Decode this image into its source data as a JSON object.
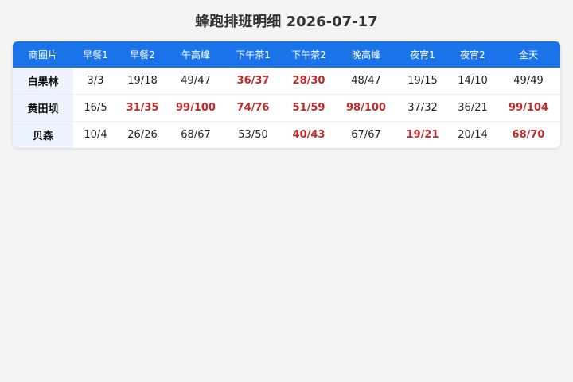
{
  "title": "蜂跑排班明细 2026-07-17",
  "colors": {
    "header_bg": "#1a73e8",
    "hot_text": "#c62828",
    "area_bg": "#eef4ff"
  },
  "table": {
    "headers": [
      "商圈片",
      "早餐1",
      "早餐2",
      "午高峰",
      "下午茶1",
      "下午茶2",
      "晚高峰",
      "夜宵1",
      "夜宵2",
      "全天"
    ],
    "rows": [
      {
        "area": "白果林",
        "cells": [
          {
            "v": "3/3",
            "hot": false
          },
          {
            "v": "19/18",
            "hot": false
          },
          {
            "v": "49/47",
            "hot": false
          },
          {
            "v": "36/37",
            "hot": true
          },
          {
            "v": "28/30",
            "hot": true
          },
          {
            "v": "48/47",
            "hot": false
          },
          {
            "v": "19/15",
            "hot": false
          },
          {
            "v": "14/10",
            "hot": false
          },
          {
            "v": "49/49",
            "hot": false
          }
        ]
      },
      {
        "area": "黄田坝",
        "cells": [
          {
            "v": "16/5",
            "hot": false
          },
          {
            "v": "31/35",
            "hot": true
          },
          {
            "v": "99/100",
            "hot": true
          },
          {
            "v": "74/76",
            "hot": true
          },
          {
            "v": "51/59",
            "hot": true
          },
          {
            "v": "98/100",
            "hot": true
          },
          {
            "v": "37/32",
            "hot": false
          },
          {
            "v": "36/21",
            "hot": false
          },
          {
            "v": "99/104",
            "hot": true
          }
        ]
      },
      {
        "area": "贝森",
        "cells": [
          {
            "v": "10/4",
            "hot": false
          },
          {
            "v": "26/26",
            "hot": false
          },
          {
            "v": "68/67",
            "hot": false
          },
          {
            "v": "53/50",
            "hot": false
          },
          {
            "v": "40/43",
            "hot": true
          },
          {
            "v": "67/67",
            "hot": false
          },
          {
            "v": "19/21",
            "hot": true
          },
          {
            "v": "20/14",
            "hot": false
          },
          {
            "v": "68/70",
            "hot": true
          }
        ]
      }
    ]
  }
}
